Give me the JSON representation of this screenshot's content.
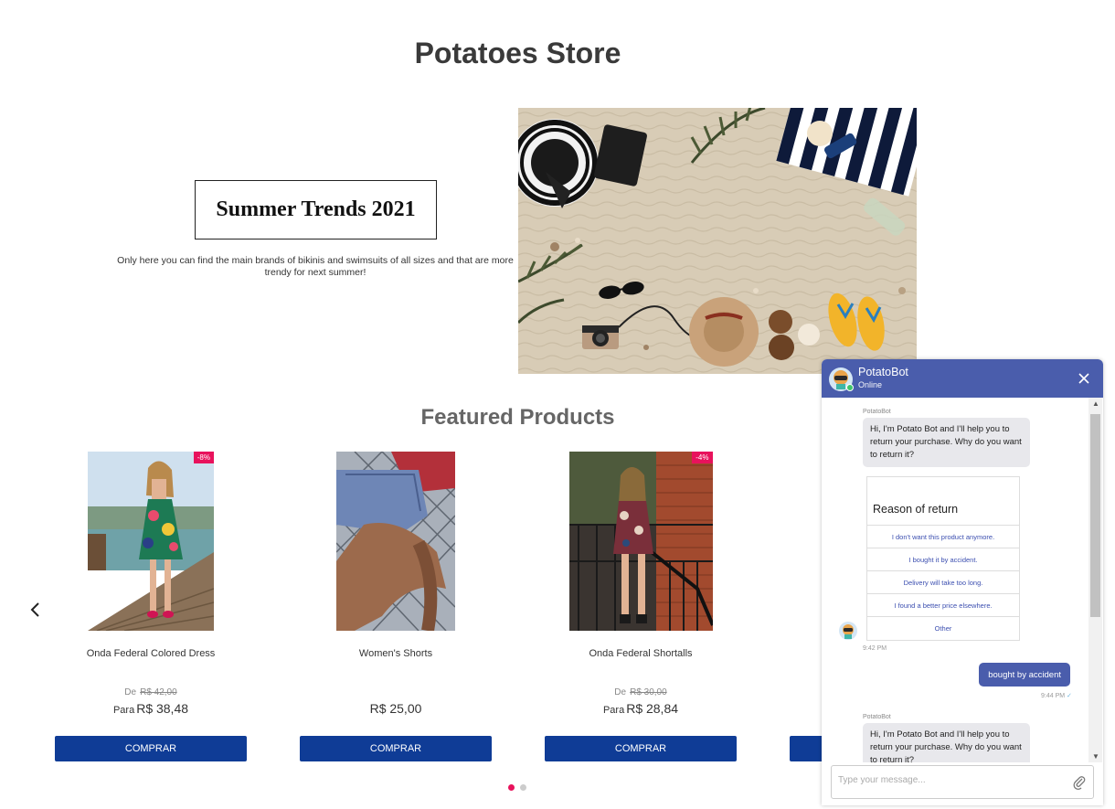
{
  "store": {
    "title": "Potatoes Store"
  },
  "hero": {
    "heading": "Summer Trends 2021",
    "description": "Only here you can find the main brands of bikinis and swimsuits of all sizes and that are more trendy for next summer!"
  },
  "featured": {
    "title": "Featured Products"
  },
  "products": [
    {
      "name": "Onda Federal Colored Dress",
      "badge": "-8%",
      "old_prefix": "De",
      "old_price": "R$ 42,00",
      "price_prefix": "Para",
      "price": "R$ 38,48",
      "button": "COMPRAR"
    },
    {
      "name": "Women's Shorts",
      "price": "R$ 25,00",
      "button": "COMPRAR"
    },
    {
      "name": "Onda Federal Shortalls",
      "badge": "-4%",
      "old_prefix": "De",
      "old_price": "R$ 30,00",
      "price_prefix": "Para",
      "price": "R$ 28,84",
      "button": "COMPRAR"
    }
  ],
  "carousel": {
    "dots": 2,
    "active": 0
  },
  "chat": {
    "bot_name": "PotatoBot",
    "status": "Online",
    "messages": {
      "sender1": "PotatoBot",
      "greeting": "Hi, I'm Potato Bot and I'll help you to return your purchase. Why do you want to return it?",
      "card_title": "Reason of return",
      "options": [
        "I don't want this product anymore.",
        "I bought it by accident.",
        "Delivery will take too long.",
        "I found a better price elsewhere.",
        "Other"
      ],
      "time1": "9:42 PM",
      "user_reply": "bought by accident",
      "time2": "9:44 PM",
      "sender2": "PotatoBot",
      "greeting2": "Hi, I'm Potato Bot and I'll help you to return your purchase. Why do you want to return it?"
    },
    "input_placeholder": "Type your message..."
  },
  "colors": {
    "accent": "#4a5dac",
    "button": "#0f3c96",
    "badge": "#e8125c"
  }
}
